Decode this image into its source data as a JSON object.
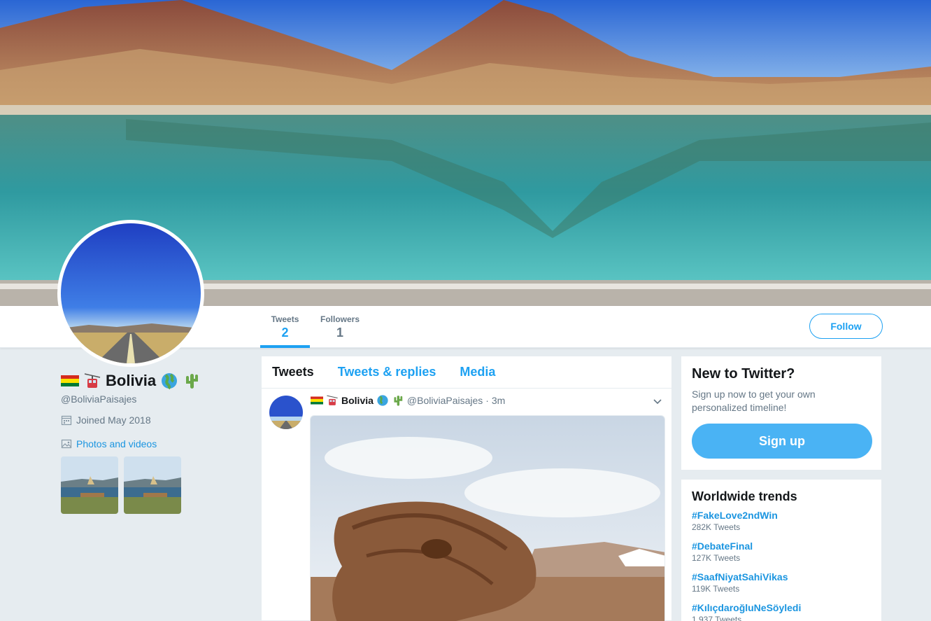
{
  "profile": {
    "name": "Bolivia",
    "handle": "@BoliviaPaisajes",
    "joined": "Joined May 2018",
    "photos_link": "Photos and videos"
  },
  "stats": {
    "tweets_label": "Tweets",
    "tweets_value": "2",
    "followers_label": "Followers",
    "followers_value": "1"
  },
  "nav": {
    "follow_label": "Follow"
  },
  "tabs": [
    {
      "label": "Tweets"
    },
    {
      "label": "Tweets & replies"
    },
    {
      "label": "Media"
    }
  ],
  "tweet": {
    "name": "Bolivia",
    "handle": "@BoliviaPaisajes",
    "time": "· 3m"
  },
  "signup_card": {
    "title": "New to Twitter?",
    "text": "Sign up now to get your own personalized timeline!",
    "button": "Sign up"
  },
  "trends": {
    "title": "Worldwide trends",
    "items": [
      {
        "name": "#FakeLove2ndWin",
        "count": "282K Tweets"
      },
      {
        "name": "#DebateFinal",
        "count": "127K Tweets"
      },
      {
        "name": "#SaafNiyatSahiVikas",
        "count": "119K Tweets"
      },
      {
        "name": "#KılıçdaroğluNeSöyledi",
        "count": "1,937 Tweets"
      }
    ]
  },
  "colors": {
    "accent": "#1da1f2",
    "link": "#1b95e0",
    "background": "#e6ecf0"
  },
  "icons": [
    "bolivia-flag-icon",
    "aerial-tramway-icon",
    "globe-americas-icon",
    "cactus-icon",
    "calendar-icon",
    "image-icon",
    "chevron-down-icon"
  ]
}
